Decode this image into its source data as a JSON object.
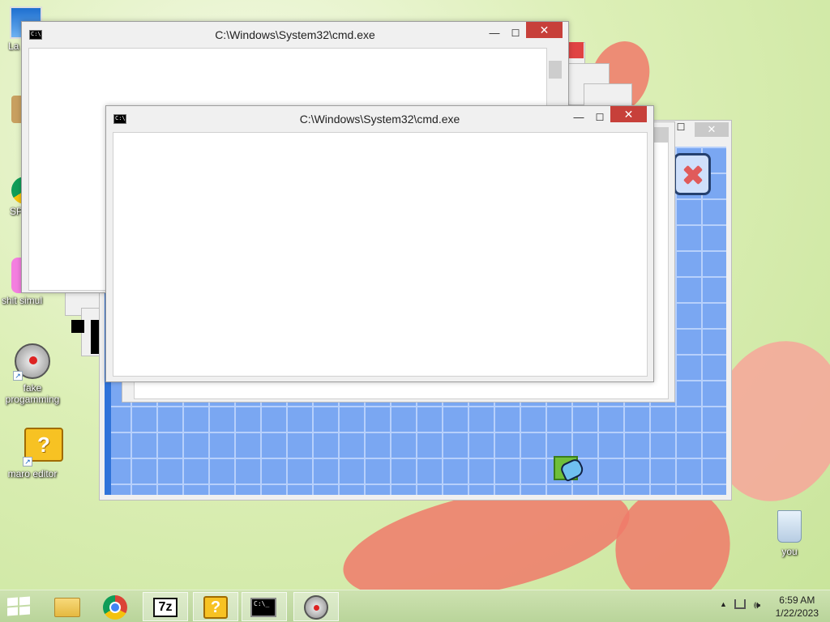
{
  "desktop": {
    "icons": [
      {
        "label": "La",
        "icon": "laptop-icon"
      },
      {
        "label": "",
        "icon": "game-icon"
      },
      {
        "label": "SP",
        "icon": "chrome-icon"
      },
      {
        "label": "shit simul",
        "icon": "pink-app-icon"
      },
      {
        "label": "fake progamming",
        "icon": "compass-app-icon"
      },
      {
        "label": "maro editor",
        "icon": "question-block-icon"
      },
      {
        "label": "you",
        "icon": "recycle-bin-icon"
      }
    ]
  },
  "windows": {
    "cmd_back": {
      "title": "C:\\Windows\\System32\\cmd.exe",
      "min": "—",
      "max": "☐",
      "close": "✕",
      "icon_text": "C:\\."
    },
    "cmd_front": {
      "title": "C:\\Windows\\System32\\cmd.exe",
      "min": "—",
      "max": "☐",
      "close": "✕",
      "icon_text": "C:\\."
    },
    "blue_game": {
      "max": "☐",
      "close": "✕"
    }
  },
  "taskbar": {
    "items": [
      {
        "name": "start",
        "icon": "windows-logo-icon"
      },
      {
        "name": "file-explorer",
        "icon": "folder-icon"
      },
      {
        "name": "chrome",
        "icon": "chrome-icon"
      },
      {
        "name": "7zip",
        "icon": "7z-icon",
        "text": "7z"
      },
      {
        "name": "maro-editor",
        "icon": "question-block-icon",
        "text": "?"
      },
      {
        "name": "cmd",
        "icon": "cmd-icon",
        "text": "C:\\_"
      },
      {
        "name": "fake-programming",
        "icon": "compass-app-icon"
      }
    ],
    "time": "6:59 AM",
    "date": "1/22/2023"
  },
  "colors": {
    "close_red": "#c7403a",
    "game_blue": "#7aa7f2",
    "taskbar_green": "#c2db a4"
  }
}
